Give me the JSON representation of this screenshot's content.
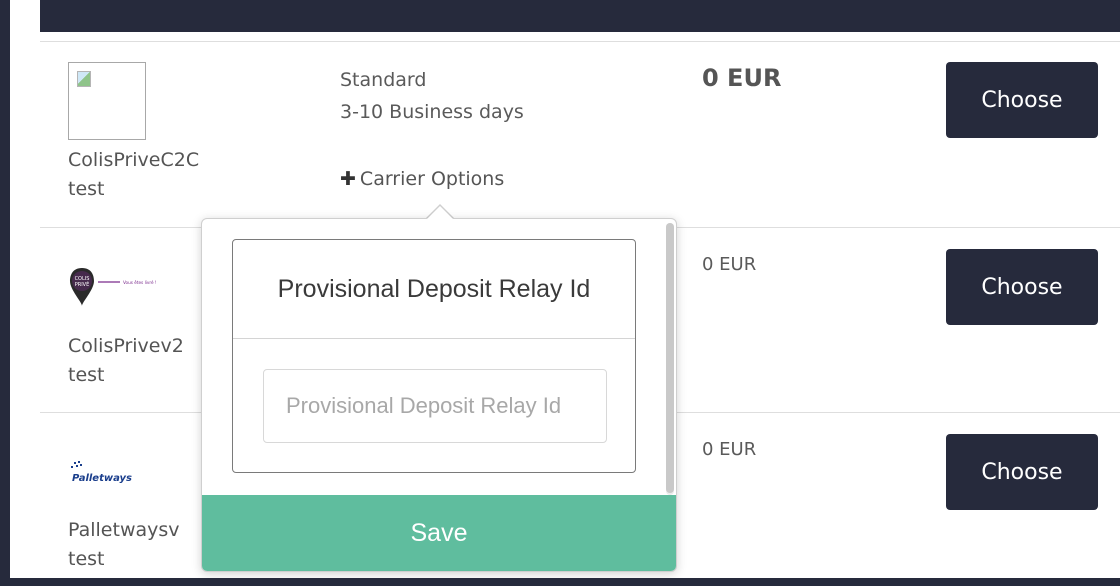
{
  "rows": [
    {
      "carrier_name": "ColisPriveC2C",
      "carrier_sub": "test",
      "service": "Standard",
      "delay": "3-10 Business days",
      "price": "0 EUR",
      "choose_label": "Choose",
      "options_label": "Carrier Options",
      "logo": "broken-image-icon"
    },
    {
      "carrier_name": "ColisPrivev2",
      "carrier_sub": "test",
      "price": "0 EUR",
      "choose_label": "Choose",
      "logo": "colisprive-logo",
      "logo_text": "COLIS PRIVÉ",
      "logo_tagline": "Vous êtes livré !"
    },
    {
      "carrier_name": "Palletwaysv",
      "carrier_sub": "test",
      "price": "0 EUR",
      "choose_label": "Choose",
      "logo": "palletways-logo",
      "logo_text": "Palletways"
    }
  ],
  "popover": {
    "title": "Provisional Deposit Relay Id",
    "input_placeholder": "Provisional Deposit Relay Id",
    "input_value": "",
    "save_label": "Save"
  },
  "colors": {
    "dark": "#262a3c",
    "save_green": "#5fbd9e",
    "logo_purple": "#7a2a8c"
  }
}
